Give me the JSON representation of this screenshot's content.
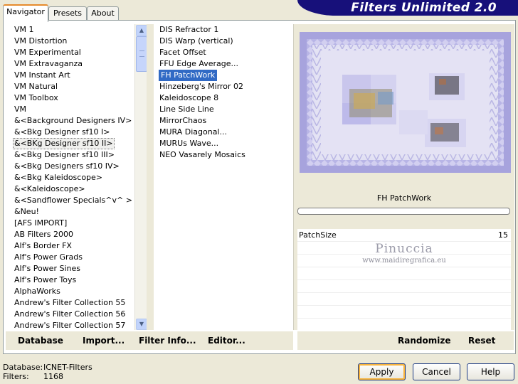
{
  "title": "Filters Unlimited 2.0",
  "tabs": [
    {
      "label": "Navigator",
      "active": true
    },
    {
      "label": "Presets",
      "active": false
    },
    {
      "label": "About",
      "active": false
    }
  ],
  "categories": [
    "VM 1",
    "VM Distortion",
    "VM Experimental",
    "VM Extravaganza",
    "VM Instant Art",
    "VM Natural",
    "VM Toolbox",
    "VM",
    "&<Background Designers IV>",
    "&<Bkg Designer sf10 I>",
    "&<BKg Designer sf10 II>",
    "&<Bkg Designer sf10 III>",
    "&<Bkg Designers sf10 IV>",
    "&<Bkg Kaleidoscope>",
    "&<Kaleidoscope>",
    "&<Sandflower Specials^v^ >",
    "&Neu!",
    "[AFS IMPORT]",
    "AB Filters 2000",
    "Alf's Border FX",
    "Alf's Power Grads",
    "Alf's Power Sines",
    "Alf's Power Toys",
    "AlphaWorks",
    "Andrew's Filter Collection 55",
    "Andrew's Filter Collection 56",
    "Andrew's Filter Collection 57"
  ],
  "selected_category": "&<BKg Designer sf10 II>",
  "filters": [
    "DIS Refractor 1",
    "DIS Warp (vertical)",
    "Facet Offset",
    "FFU Edge Average...",
    "FH PatchWork",
    "Hinzeberg's Mirror 02",
    "Kaleidoscope 8",
    "Line Side Line",
    "MirrorChaos",
    "MURA Diagonal...",
    "MURUs Wave...",
    "NEO Vasarely Mosaics"
  ],
  "selected_filter": "FH PatchWork",
  "bottom_left": {
    "database": "Database",
    "import": "Import...",
    "filter_info": "Filter Info...",
    "editor": "Editor..."
  },
  "filter_name_display": "FH PatchWork",
  "params": [
    {
      "label": "PatchSize",
      "value": "15"
    }
  ],
  "watermark": {
    "name": "Pinuccia",
    "url": "www.maidiregrafica.eu"
  },
  "bottom_right": {
    "randomize": "Randomize",
    "reset": "Reset"
  },
  "status": {
    "database_label": "Database:",
    "database_value": "ICNET-Filters",
    "filters_label": "Filters:",
    "filters_value": "1168"
  },
  "dialog_buttons": {
    "apply": "Apply",
    "cancel": "Cancel",
    "help": "Help"
  },
  "colors": {
    "banner": "#17107a",
    "selection": "#316ac5",
    "preview_frame": "#a7a3dd",
    "tab_highlight": "#e68b2c"
  },
  "icons": {
    "scroll_up": "chevron-up-icon",
    "scroll_down": "chevron-down-icon",
    "scroll_grip": "grip-icon"
  }
}
